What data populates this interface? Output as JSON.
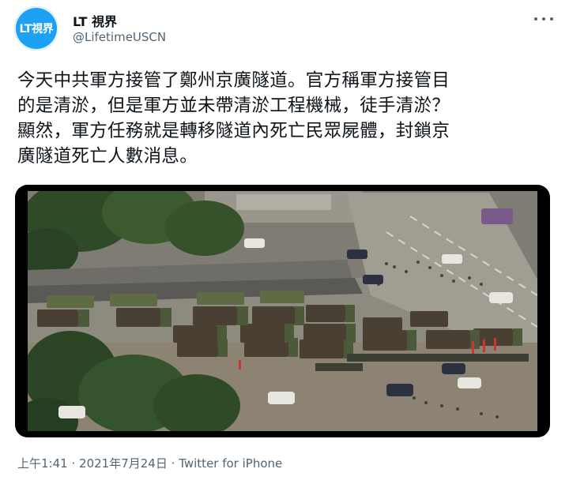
{
  "author": {
    "avatar_text": "LT視界",
    "display_name": "LT 視界",
    "handle": "@LifetimeUSCN"
  },
  "tweet": {
    "text": "今天中共軍方接管了鄭州京廣隧道。官方稱軍方接管目\n的是清淤，但是軍方並未帶清淤工程機械，徒手清淤？\n顯然，軍方任務就是轉移隧道內死亡民眾屍體，封鎖京\n廣隧道死亡人數消息。"
  },
  "meta": {
    "time": "上午1:41",
    "separator1": "·",
    "date": "2021年7月24日",
    "separator2": "·",
    "source": "Twitter for iPhone"
  },
  "icons": {
    "more": "more-horizontal-icon"
  },
  "colors": {
    "brand": "#1da1f2",
    "text": "#0f1419",
    "secondary": "#536471"
  }
}
